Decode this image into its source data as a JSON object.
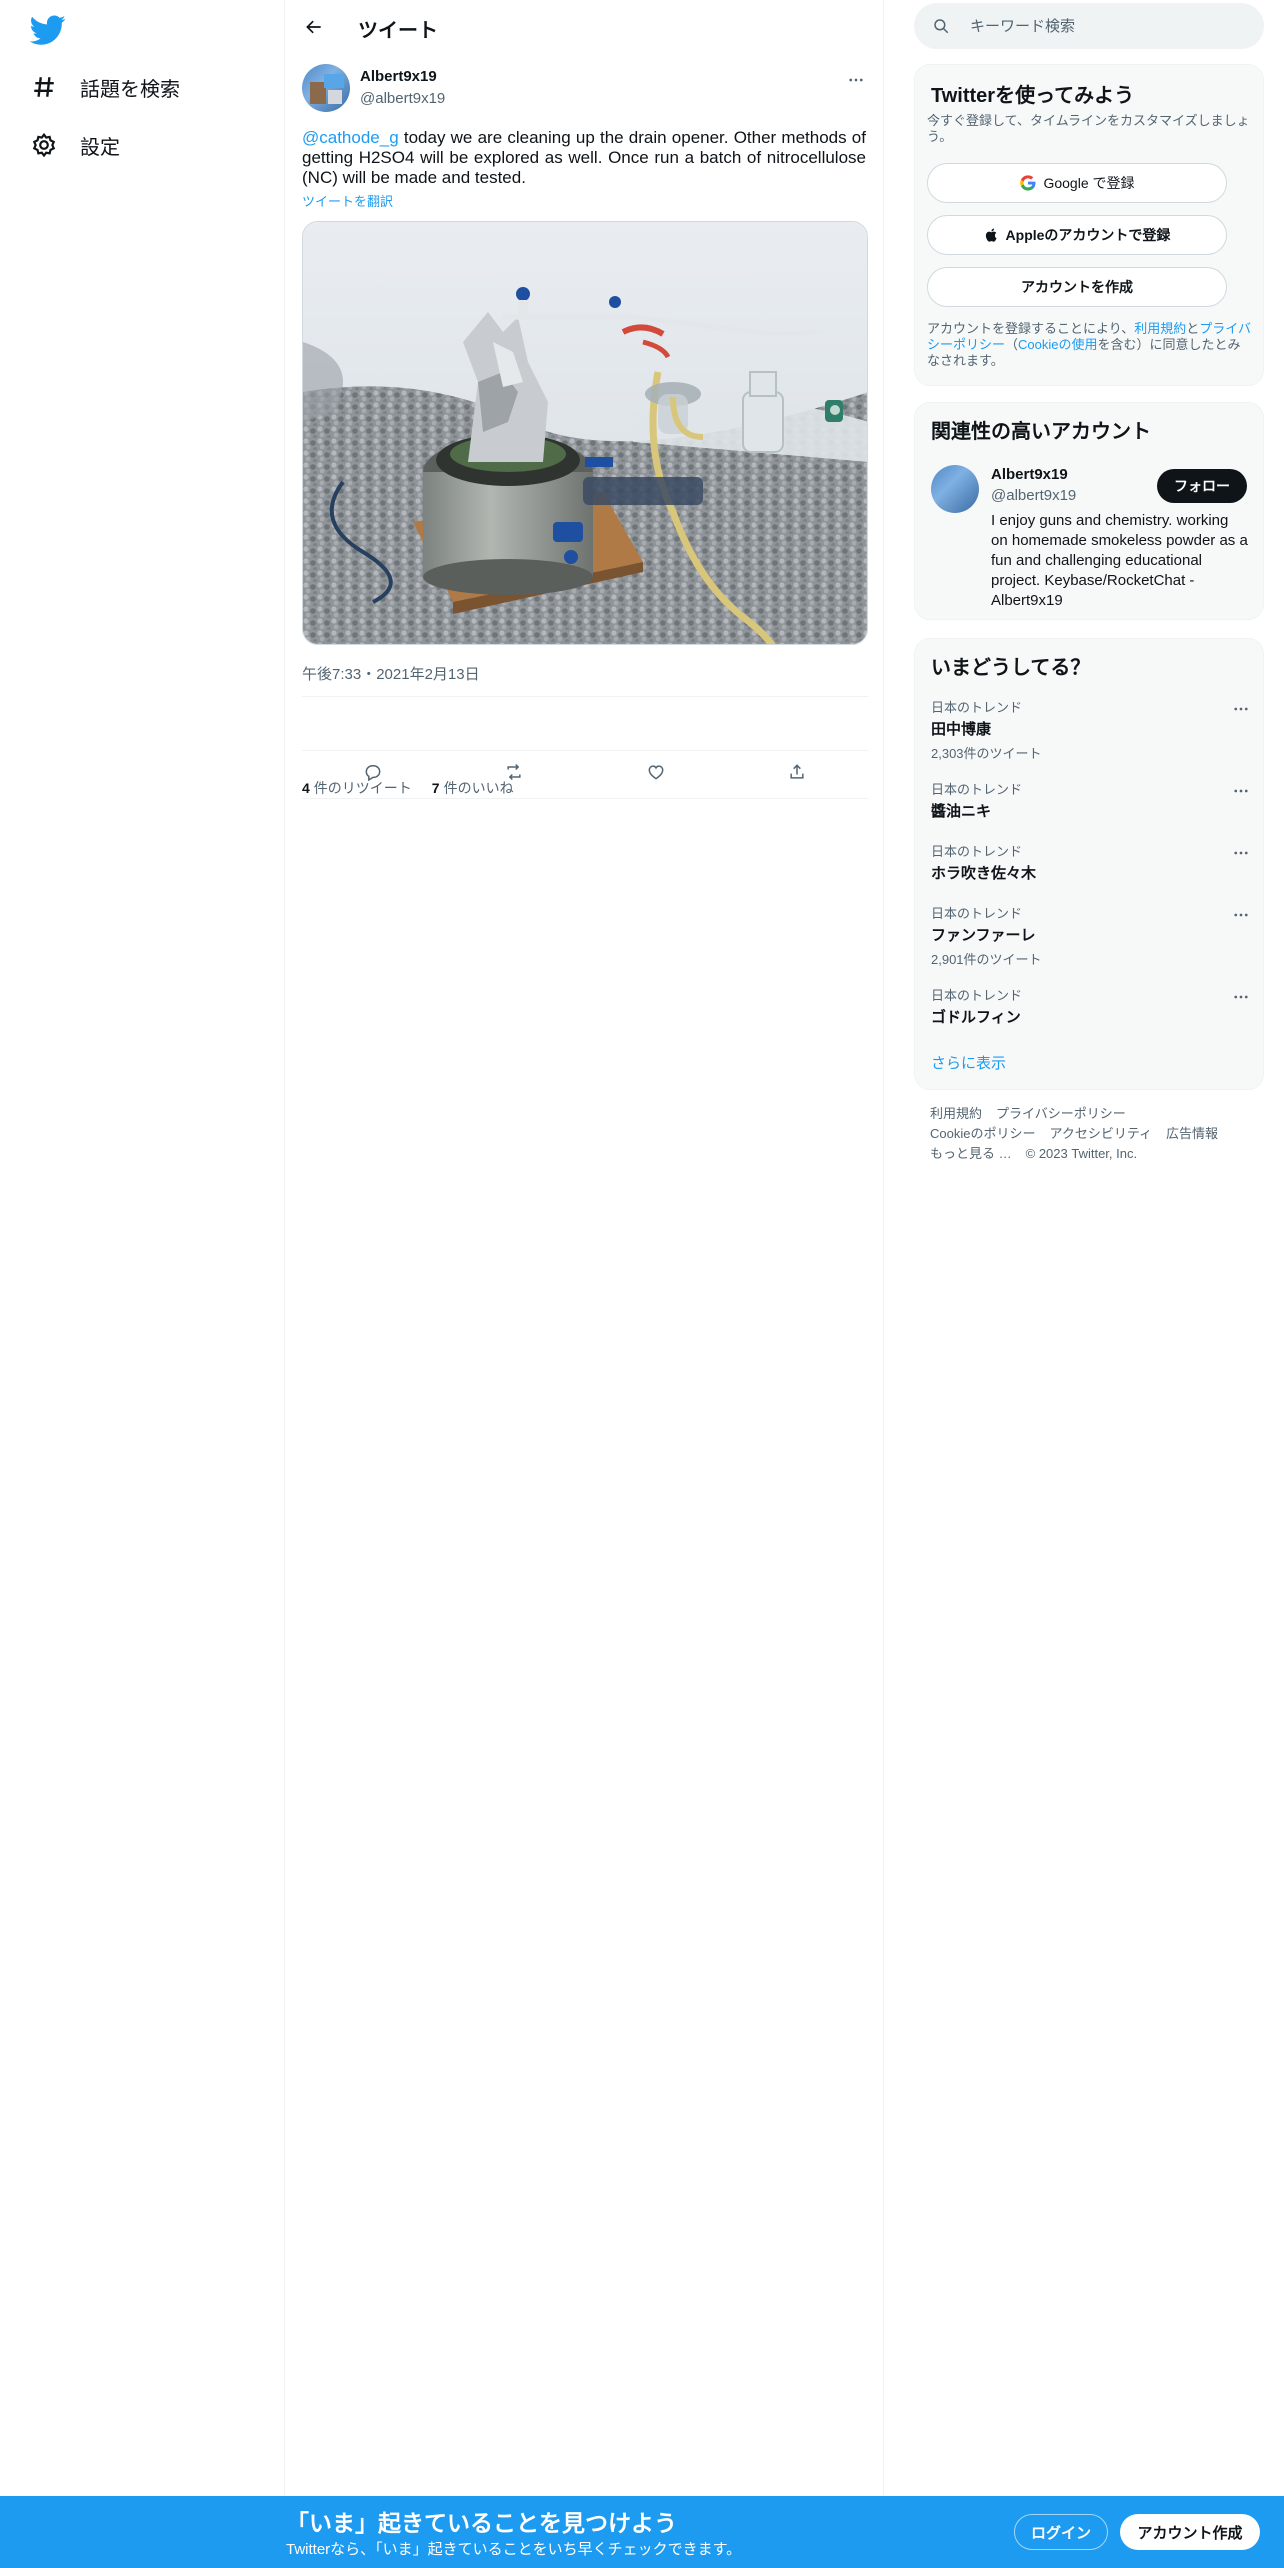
{
  "nav": {
    "items": [
      {
        "label": "話題を検索",
        "icon": "hashtag-icon"
      },
      {
        "label": "設定",
        "icon": "gear-icon"
      }
    ]
  },
  "header": {
    "title": "ツイート"
  },
  "tweet": {
    "author_name": "Albert9x19",
    "author_handle": "@albert9x19",
    "mention": "@cathode_g",
    "text": " today we are cleaning up the drain opener. Other methods of getting H2SO4 will be explored as well. Once run a batch of nitrocellulose (NC) will be made and tested.",
    "translate_label": "ツイートを翻訳",
    "timestamp": "午後7:33・2021年2月13日",
    "retweets_count": "4",
    "retweets_label": "件のリツイート",
    "likes_count": "7",
    "likes_label": "件のいいね"
  },
  "search": {
    "placeholder": "キーワード検索"
  },
  "signup_card": {
    "title": "Twitterを使ってみよう",
    "subtitle": "今すぐ登録して、タイムラインをカスタマイズしましょう。",
    "google_label": "Google で登録",
    "apple_label": "Appleのアカウントで登録",
    "create_label": "アカウントを作成",
    "legal_prefix": "アカウントを登録することにより、",
    "legal_terms": "利用規約",
    "legal_and": "と",
    "legal_privacy": "プライバシーポリシー",
    "legal_open": "（",
    "legal_cookie": "Cookieの使用",
    "legal_suffix": "を含む）に同意したとみなされます。"
  },
  "related_card": {
    "title": "関連性の高いアカウント",
    "name": "Albert9x19",
    "handle": "@albert9x19",
    "follow_label": "フォロー",
    "bio": "I enjoy guns and chemistry. working on homemade smokeless powder as a fun and challenging educational project. Keybase/RocketChat - Albert9x19"
  },
  "trends_card": {
    "title": "いまどうしてる？",
    "items": [
      {
        "category": "日本のトレンド",
        "name": "田中博康",
        "count": "2,303件のツイート"
      },
      {
        "category": "日本のトレンド",
        "name": "醬油ニキ",
        "count": ""
      },
      {
        "category": "日本のトレンド",
        "name": "ホラ吹き佐々木",
        "count": ""
      },
      {
        "category": "日本のトレンド",
        "name": "ファンファーレ",
        "count": "2,901件のツイート"
      },
      {
        "category": "日本のトレンド",
        "name": "ゴドルフィン",
        "count": ""
      }
    ],
    "show_more": "さらに表示"
  },
  "footer": {
    "links": [
      "利用規約",
      "プライバシーポリシー",
      "Cookieのポリシー",
      "アクセシビリティ",
      "広告情報",
      "もっと見る …"
    ],
    "copyright": "© 2023 Twitter, Inc."
  },
  "bottom_bar": {
    "title": "「いま」起きていることを見つけよう",
    "subtitle": "Twitterなら、「いま」起きていることをいち早くチェックできます。",
    "login_label": "ログイン",
    "signup_label": "アカウント作成"
  },
  "colors": {
    "accent": "#1d9bf0",
    "dark": "#0f1419",
    "muted": "#536471"
  }
}
